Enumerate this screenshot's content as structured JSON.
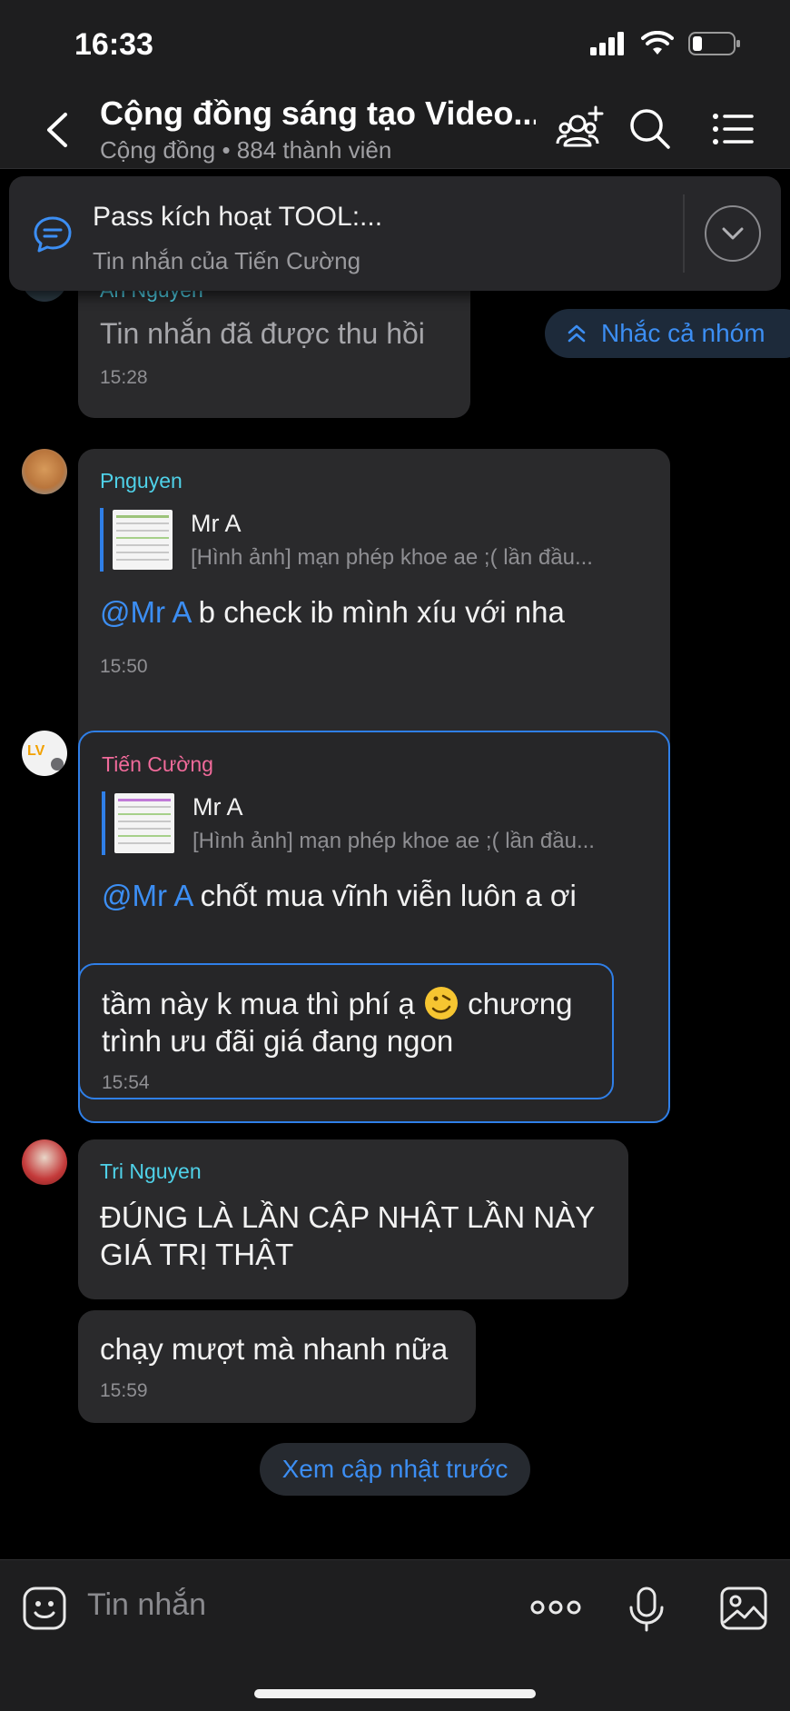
{
  "status": {
    "time": "16:33"
  },
  "header": {
    "title": "Cộng đồng sáng tạo Video...",
    "subtitle": "Cộng đồng • 884 thành viên"
  },
  "pinned": {
    "title": "Pass kích hoạt TOOL:...",
    "subtitle": "Tin nhắn của Tiến Cường"
  },
  "remind_all": {
    "label": "Nhắc cả nhóm"
  },
  "messages": [
    {
      "sender": "An Nguyên",
      "sender_color": "#4fd1e8",
      "text": "Tin nhắn đã được thu hồi",
      "time": "15:28"
    },
    {
      "sender": "Pnguyen",
      "sender_color": "#4fd1e8",
      "quote_name": "Mr A",
      "quote_text": "[Hình ảnh] mạn phép khoe ae ;( lần đầu...",
      "mention": "@Mr A",
      "text": " b check ib mình xíu với nha",
      "time": "15:50"
    },
    {
      "sender": "Tiến Cường",
      "sender_color": "#f06a9a",
      "quote_name": "Mr A",
      "quote_text": "[Hình ảnh] mạn phép khoe ae ;( lần đầu...",
      "mention": "@Mr A",
      "text": " chốt mua vĩnh viễn luôn a ơi"
    },
    {
      "text_a": "tầm này k mua thì phí ạ ",
      "text_b": " chương trình ưu đãi giá đang ngon",
      "time": "15:54"
    },
    {
      "sender": "Tri Nguyen",
      "sender_color": "#4fd1e8",
      "text": "ĐÚNG LÀ LẦN CẬP NHẬT LẦN NÀY GIÁ TRỊ THẬT"
    },
    {
      "text": "chạy mượt mà nhanh nữa",
      "time": "15:59"
    }
  ],
  "load_previous": {
    "label": "Xem cập nhật trước"
  },
  "composer": {
    "placeholder": "Tin nhắn"
  },
  "colors": {
    "accent": "#2f7fe8",
    "link": "#3c8ef3",
    "bubble": "#2a2a2c",
    "background": "#000000"
  }
}
